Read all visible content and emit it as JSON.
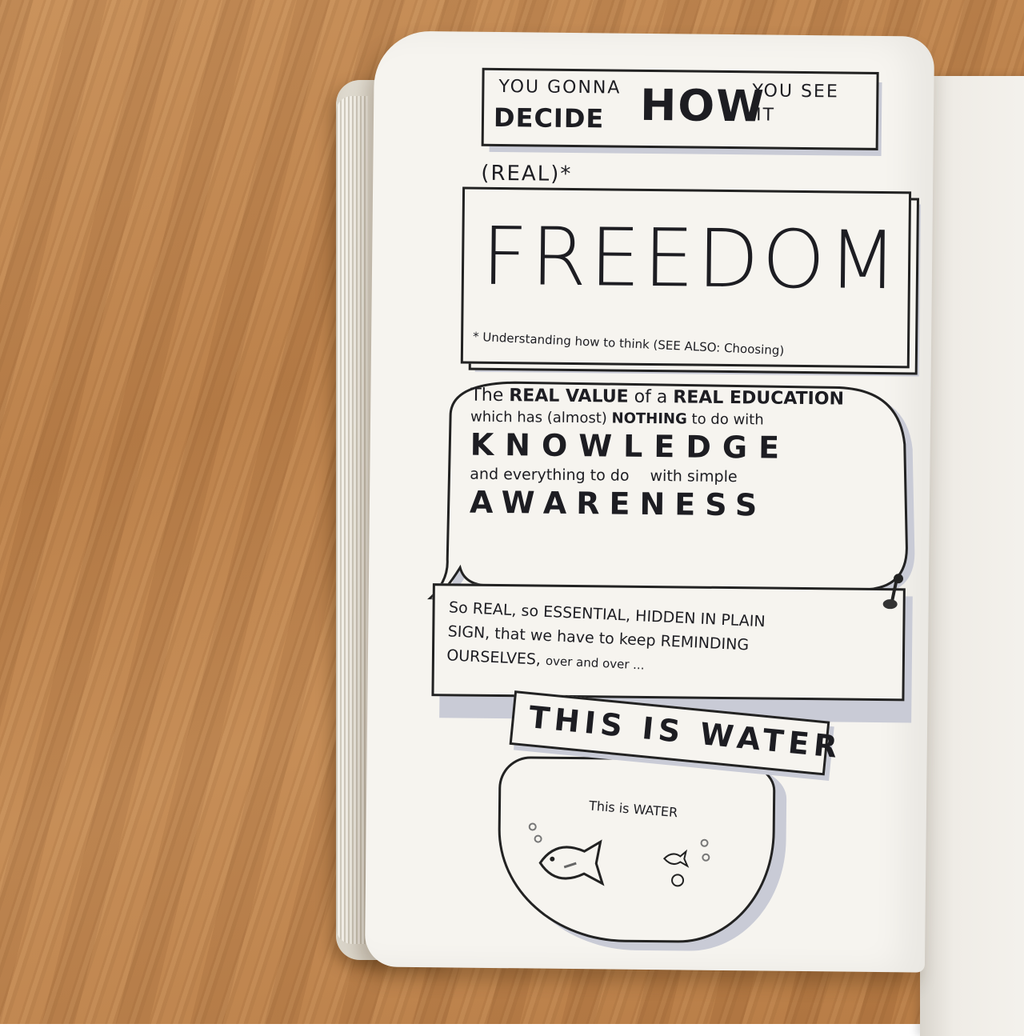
{
  "sketch": {
    "heading": {
      "you_gonna": "YOU GONNA",
      "decide": "DECIDE",
      "how": "HOW",
      "you_see": "YOU SEE",
      "it": "IT"
    },
    "freedom": {
      "real_note": "(REAL)*",
      "title": "FREEDOM",
      "footnote": "* Understanding how to think (SEE ALSO: Choosing)"
    },
    "speech_bubble": {
      "line1_a": "The",
      "line1_b": "REAL VALUE",
      "line1_c": "of a",
      "line1_d": "REAL EDUCATION",
      "line2_a": "which has (almost)",
      "line2_b": "NOTHING",
      "line2_c": "to do with",
      "line3": "KNOWLEDGE",
      "line4_a": "and everything to do",
      "line4_b": "with simple",
      "line5": "AWARENESS"
    },
    "reminder": {
      "line1": "So REAL, so ESSENTIAL, HIDDEN IN PLAIN",
      "line2": "SIGN, that we have to keep REMINDING",
      "line3_a": "OURSELVES,",
      "line3_b": "over and over ..."
    },
    "banner": "THIS IS WATER",
    "bowl_caption": "This is WATER"
  }
}
